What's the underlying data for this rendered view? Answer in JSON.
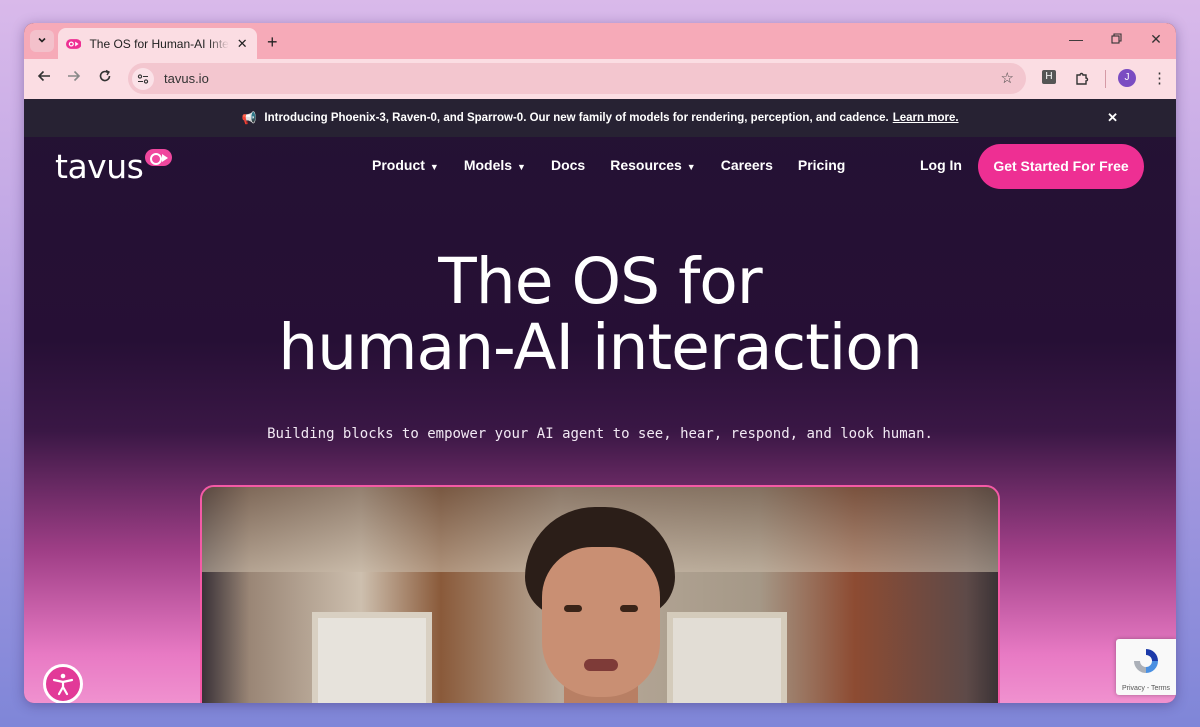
{
  "browser": {
    "tab_title": "The OS for Human-AI Interaction",
    "url": "tavus.io",
    "extension_label": "H",
    "profile_initial": "J"
  },
  "announcement": {
    "text": "Introducing Phoenix-3, Raven-0, and Sparrow-0. Our new family of models for rendering, perception, and cadence.",
    "link": "Learn more."
  },
  "nav": {
    "logo": "tavus",
    "items": [
      {
        "label": "Product",
        "dropdown": true
      },
      {
        "label": "Models",
        "dropdown": true
      },
      {
        "label": "Docs",
        "dropdown": false
      },
      {
        "label": "Resources",
        "dropdown": true
      },
      {
        "label": "Careers",
        "dropdown": false
      },
      {
        "label": "Pricing",
        "dropdown": false
      }
    ],
    "login": "Log In",
    "cta": "Get Started For Free"
  },
  "hero": {
    "title_line1": "The OS for",
    "title_line2": "human-AI interaction",
    "subtitle": "Building blocks to empower your AI agent to see, hear, respond, and look human."
  },
  "recaptcha": {
    "terms": "Privacy - Terms"
  },
  "colors": {
    "accent": "#ee2f93",
    "browser_frame": "#f6aab8",
    "page_bg": "#241233"
  }
}
